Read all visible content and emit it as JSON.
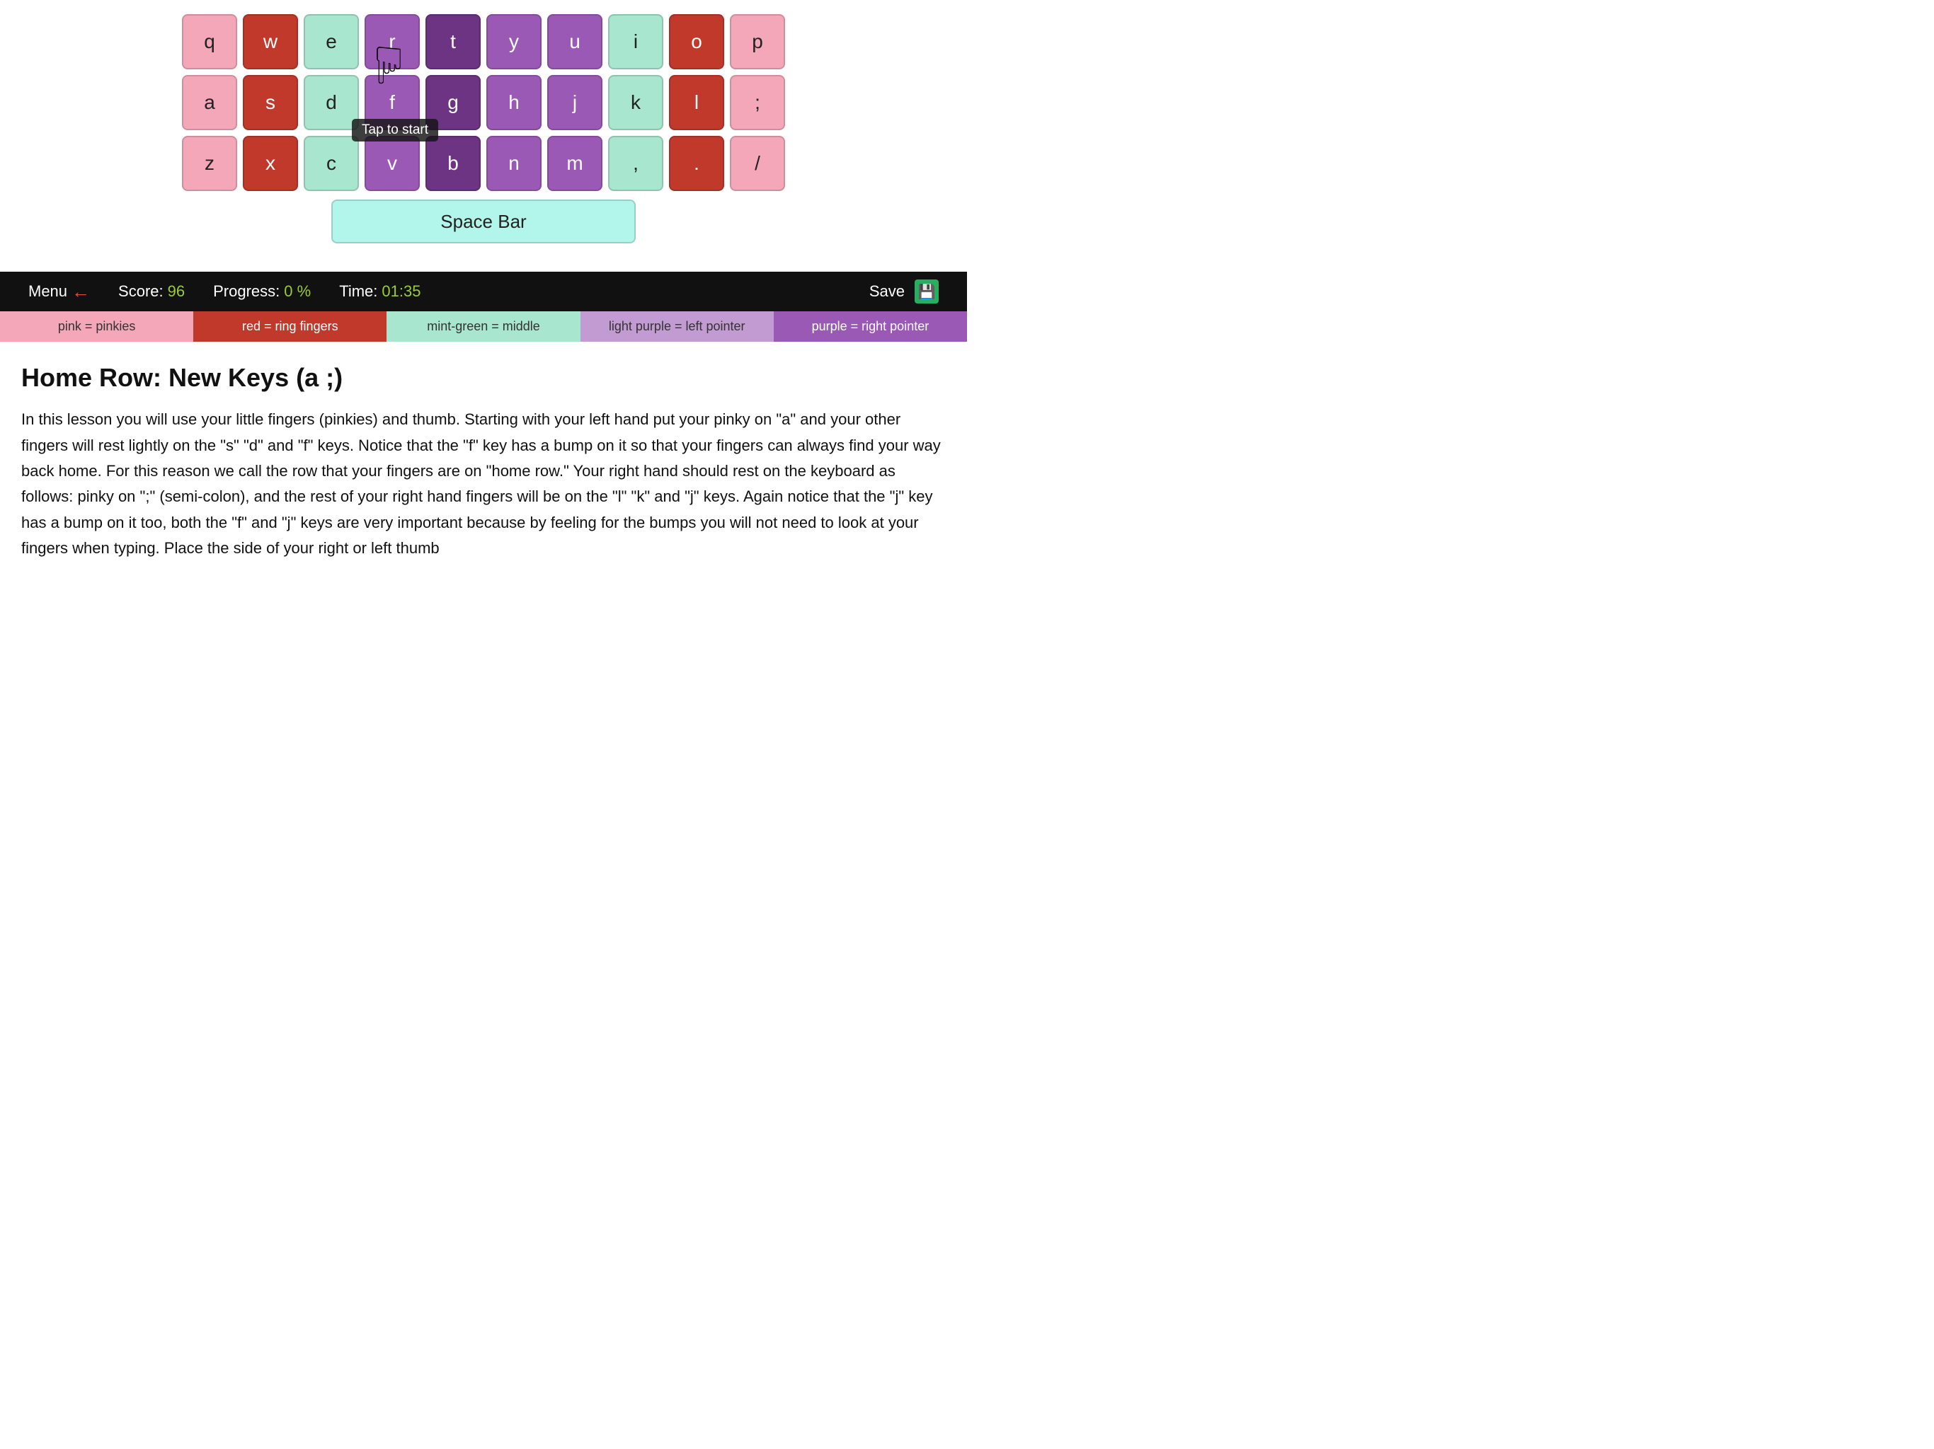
{
  "keyboard": {
    "rows": [
      {
        "keys": [
          {
            "label": "q",
            "color": "pink"
          },
          {
            "label": "w",
            "color": "red"
          },
          {
            "label": "e",
            "color": "green"
          },
          {
            "label": "r",
            "color": "purple"
          },
          {
            "label": "t",
            "color": "dark-purple"
          },
          {
            "label": "y",
            "color": "purple"
          },
          {
            "label": "u",
            "color": "purple"
          },
          {
            "label": "i",
            "color": "green"
          },
          {
            "label": "o",
            "color": "red"
          },
          {
            "label": "p",
            "color": "pink"
          }
        ]
      },
      {
        "keys": [
          {
            "label": "a",
            "color": "pink"
          },
          {
            "label": "s",
            "color": "red"
          },
          {
            "label": "d",
            "color": "green"
          },
          {
            "label": "f",
            "color": "purple"
          },
          {
            "label": "g",
            "color": "dark-purple"
          },
          {
            "label": "h",
            "color": "purple"
          },
          {
            "label": "j",
            "color": "purple"
          },
          {
            "label": "k",
            "color": "green"
          },
          {
            "label": "l",
            "color": "red"
          },
          {
            "label": ";",
            "color": "pink"
          }
        ]
      },
      {
        "keys": [
          {
            "label": "z",
            "color": "pink"
          },
          {
            "label": "x",
            "color": "red"
          },
          {
            "label": "c",
            "color": "green"
          },
          {
            "label": "v",
            "color": "purple"
          },
          {
            "label": "b",
            "color": "dark-purple"
          },
          {
            "label": "n",
            "color": "purple"
          },
          {
            "label": "m",
            "color": "purple"
          },
          {
            "label": ",",
            "color": "green"
          },
          {
            "label": ".",
            "color": "red"
          },
          {
            "label": "/",
            "color": "pink"
          }
        ]
      }
    ],
    "spacebar_label": "Space Bar",
    "tap_to_start": "Tap to start"
  },
  "menubar": {
    "menu_label": "Menu",
    "score_label": "Score:",
    "score_value": "96",
    "progress_label": "Progress:",
    "progress_value": "0 %",
    "time_label": "Time:",
    "time_value": "01:35",
    "save_label": "Save"
  },
  "legend": [
    {
      "label": "pink = pinkies",
      "color": "pink"
    },
    {
      "label": "red = ring fingers",
      "color": "red"
    },
    {
      "label": "mint-green = middle",
      "color": "green"
    },
    {
      "label": "light purple = left pointer",
      "color": "light-purple"
    },
    {
      "label": "purple = right pointer",
      "color": "purple"
    }
  ],
  "content": {
    "title": "Home Row: New Keys (a ;)",
    "body": "In this lesson you will use your little fingers (pinkies) and thumb. Starting with your left hand put your pinky on \"a\" and your other fingers will rest lightly on the \"s\" \"d\" and \"f\" keys. Notice that the \"f\" key has a bump on it so that your fingers can always find your way back home. For this reason we call the row that your fingers are on \"home row.\" Your right hand should rest on the keyboard as follows: pinky on \";\" (semi-colon), and the rest of your right hand fingers will be on the \"l\" \"k\" and \"j\" keys. Again notice that the \"j\" key has a bump on it too, both the \"f\" and \"j\" keys are very important because by feeling for the bumps you will not need to look at your fingers when typing. Place the side of your right or left thumb"
  }
}
